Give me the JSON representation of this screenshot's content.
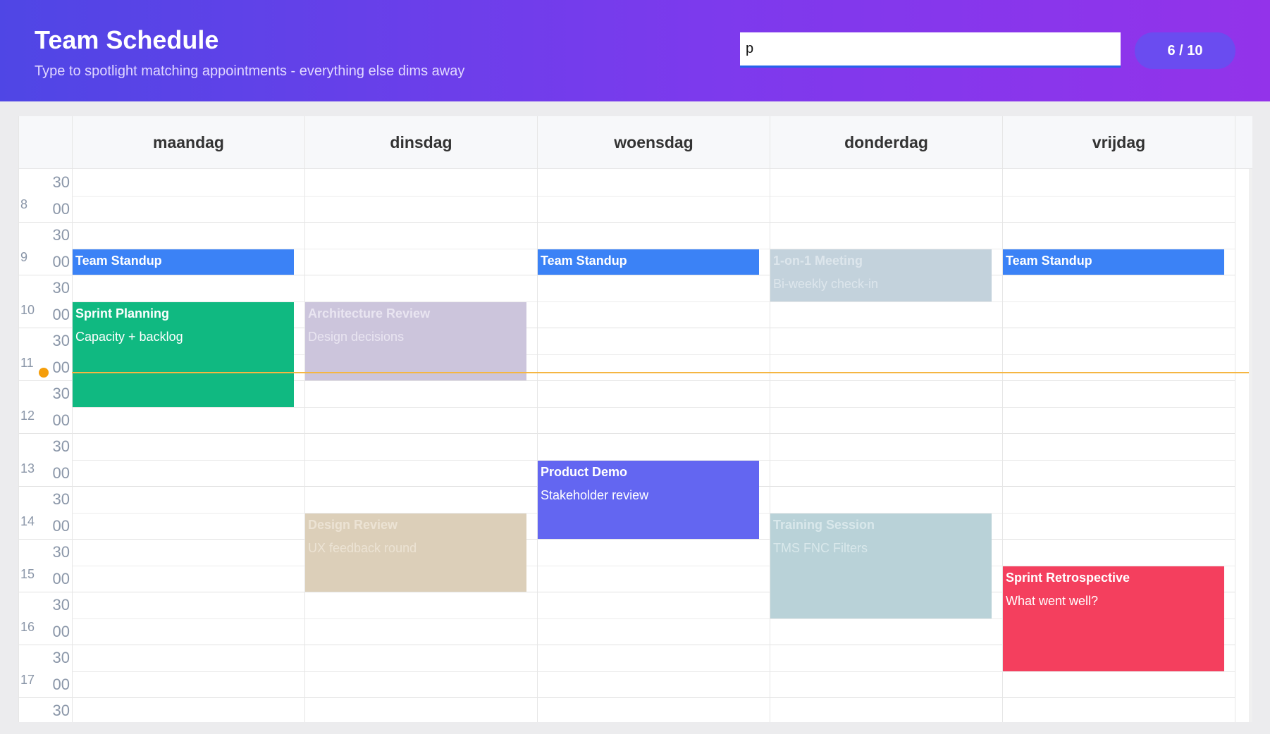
{
  "header": {
    "title": "Team Schedule",
    "subtitle": "Type to spotlight matching appointments - everything else dims away",
    "search_value": "p",
    "match_count": "6 / 10"
  },
  "days": [
    "maandag",
    "dinsdag",
    "woensdag",
    "donderdag",
    "vrijdag"
  ],
  "time_rows": [
    {
      "hour": "",
      "minute": "30"
    },
    {
      "hour": "8",
      "minute": "00"
    },
    {
      "hour": "",
      "minute": "30"
    },
    {
      "hour": "9",
      "minute": "00"
    },
    {
      "hour": "",
      "minute": "30"
    },
    {
      "hour": "10",
      "minute": "00"
    },
    {
      "hour": "",
      "minute": "30"
    },
    {
      "hour": "11",
      "minute": "00"
    },
    {
      "hour": "",
      "minute": "30"
    },
    {
      "hour": "12",
      "minute": "00"
    },
    {
      "hour": "",
      "minute": "30"
    },
    {
      "hour": "13",
      "minute": "00"
    },
    {
      "hour": "",
      "minute": "30"
    },
    {
      "hour": "14",
      "minute": "00"
    },
    {
      "hour": "",
      "minute": "30"
    },
    {
      "hour": "15",
      "minute": "00"
    },
    {
      "hour": "",
      "minute": "30"
    },
    {
      "hour": "16",
      "minute": "00"
    },
    {
      "hour": "",
      "minute": "30"
    },
    {
      "hour": "17",
      "minute": "00"
    },
    {
      "hour": "",
      "minute": "30"
    }
  ],
  "appointments": [
    {
      "day": 0,
      "start": "9:00",
      "end": "9:30",
      "title": "Team Standup",
      "subtitle": "",
      "color": "#3b82f6",
      "text_color": "#ffffff",
      "matched": true
    },
    {
      "day": 0,
      "start": "10:00",
      "end": "12:00",
      "title": "Sprint Planning",
      "subtitle": "Capacity + backlog",
      "color": "#10b981",
      "text_color": "#ffffff",
      "matched": true
    },
    {
      "day": 1,
      "start": "10:00",
      "end": "11:30",
      "title": "Architecture Review",
      "subtitle": "Design decisions",
      "color": "#ccc5dc",
      "text_color": "#e9e5f1",
      "matched": false
    },
    {
      "day": 1,
      "start": "14:00",
      "end": "15:30",
      "title": "Design Review",
      "subtitle": "UX feedback round",
      "color": "#dccfb9",
      "text_color": "#ece3d4",
      "matched": false
    },
    {
      "day": 2,
      "start": "9:00",
      "end": "9:30",
      "title": "Team Standup",
      "subtitle": "",
      "color": "#3b82f6",
      "text_color": "#ffffff",
      "matched": true
    },
    {
      "day": 2,
      "start": "13:00",
      "end": "14:30",
      "title": "Product Demo",
      "subtitle": "Stakeholder review",
      "color": "#6366f1",
      "text_color": "#ffffff",
      "matched": true
    },
    {
      "day": 3,
      "start": "9:00",
      "end": "10:00",
      "title": "1-on-1 Meeting",
      "subtitle": "Bi-weekly check-in",
      "color": "#c3d2dc",
      "text_color": "#dde6ec",
      "matched": false
    },
    {
      "day": 3,
      "start": "14:00",
      "end": "16:00",
      "title": "Training Session",
      "subtitle": "TMS FNC Filters",
      "color": "#b9d2d8",
      "text_color": "#d9e8eb",
      "matched": false
    },
    {
      "day": 4,
      "start": "9:00",
      "end": "9:30",
      "title": "Team Standup",
      "subtitle": "",
      "color": "#3b82f6",
      "text_color": "#ffffff",
      "matched": true
    },
    {
      "day": 4,
      "start": "15:00",
      "end": "17:00",
      "title": "Sprint Retrospective",
      "subtitle": "What went well?",
      "color": "#f43f5e",
      "text_color": "#ffffff",
      "matched": true
    }
  ],
  "icons": {
    "scroll_up": "triangle-up-icon",
    "scroll_down": "triangle-down-icon",
    "current_time": "dot-icon"
  }
}
